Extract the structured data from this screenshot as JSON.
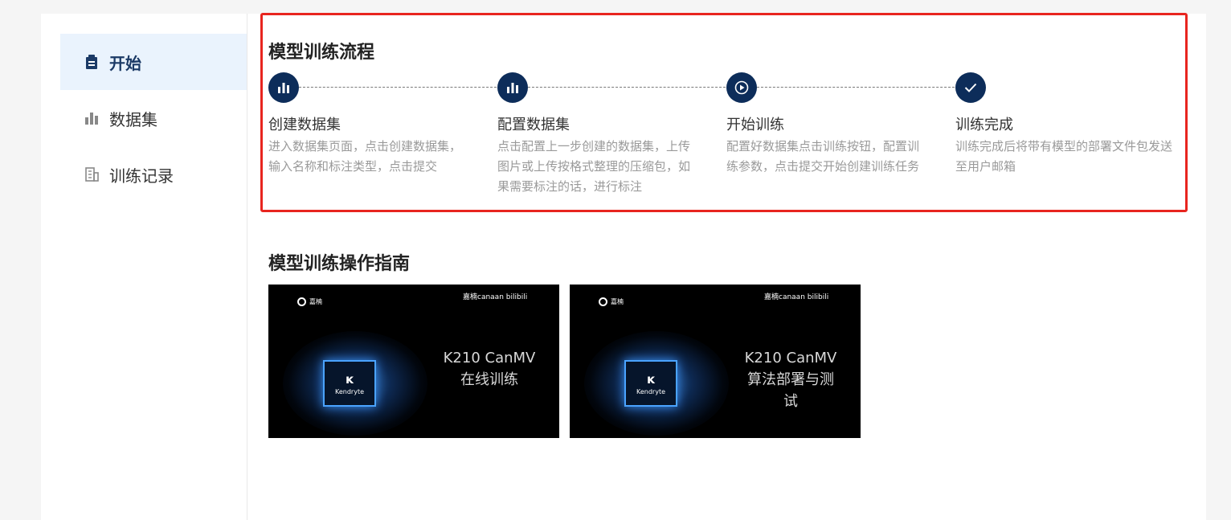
{
  "sidebar": {
    "items": [
      {
        "label": "开始",
        "icon": "clipboard-icon",
        "active": true
      },
      {
        "label": "数据集",
        "icon": "bar-chart-icon",
        "active": false
      },
      {
        "label": "训练记录",
        "icon": "building-icon",
        "active": false
      }
    ]
  },
  "flow": {
    "title": "模型训练流程",
    "steps": [
      {
        "name": "创建数据集",
        "desc": "进入数据集页面，点击创建数据集，输入名称和标注类型，点击提交",
        "icon": "bar-chart-icon"
      },
      {
        "name": "配置数据集",
        "desc": "点击配置上一步创建的数据集，上传图片或上传按格式整理的压缩包，如果需要标注的话，进行标注",
        "icon": "bar-chart-icon"
      },
      {
        "name": "开始训练",
        "desc": "配置好数据集点击训练按钮，配置训练参数，点击提交开始创建训练任务",
        "icon": "play-circle-icon"
      },
      {
        "name": "训练完成",
        "desc": "训练完成后将带有模型的部署文件包发送至用户邮箱",
        "icon": "check-icon"
      }
    ]
  },
  "guide": {
    "title": "模型训练操作指南",
    "videos": [
      {
        "line1": "K210 CanMV",
        "line2": "在线训练",
        "line3": "",
        "logo": "嘉楠",
        "brand": "嘉楠canaan bilibili",
        "chip": "Kendryte"
      },
      {
        "line1": "K210 CanMV",
        "line2": "算法部署与测",
        "line3": "试",
        "logo": "嘉楠",
        "brand": "嘉楠canaan bilibili",
        "chip": "Kendryte"
      }
    ]
  },
  "colors": {
    "accent": "#0d2d5a",
    "highlight_border": "#e8251f",
    "active_bg": "#eaf3fd"
  }
}
